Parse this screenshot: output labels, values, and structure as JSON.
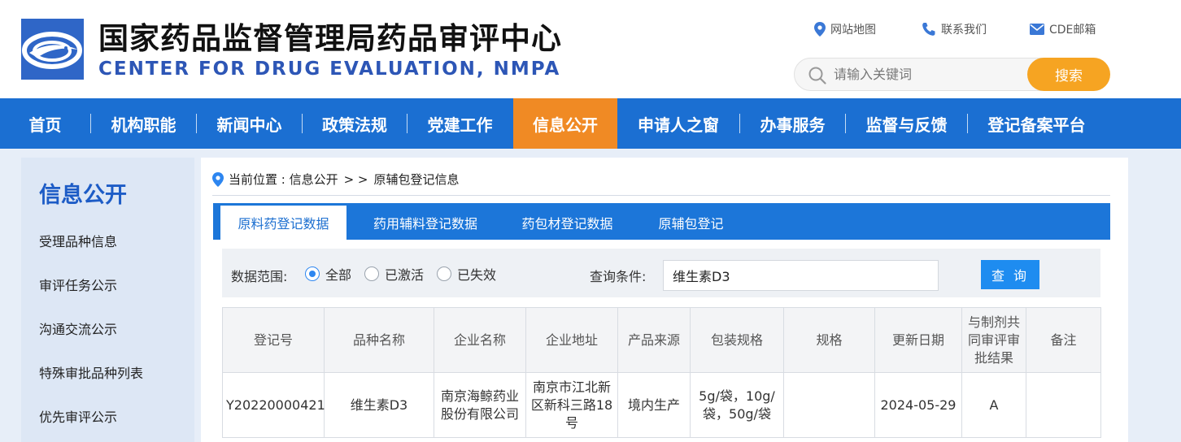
{
  "header": {
    "title": "国家药品监督管理局药品审评中心",
    "subtitle": "CENTER FOR DRUG EVALUATION, NMPA",
    "links": [
      {
        "label": "网站地图",
        "icon": "location-pin-icon"
      },
      {
        "label": "联系我们",
        "icon": "phone-icon"
      },
      {
        "label": "CDE邮箱",
        "icon": "mail-icon"
      }
    ],
    "search": {
      "placeholder": "请输入关键词",
      "button_label": "搜索"
    }
  },
  "nav": {
    "items": [
      {
        "label": "首页"
      },
      {
        "label": "机构职能"
      },
      {
        "label": "新闻中心"
      },
      {
        "label": "政策法规"
      },
      {
        "label": "党建工作"
      },
      {
        "label": "信息公开"
      },
      {
        "label": "申请人之窗"
      },
      {
        "label": "办事服务"
      },
      {
        "label": "监督与反馈"
      },
      {
        "label": "登记备案平台"
      }
    ],
    "active": "信息公开"
  },
  "sidebar": {
    "title": "信息公开",
    "items": [
      {
        "label": "受理品种信息"
      },
      {
        "label": "审评任务公示"
      },
      {
        "label": "沟通交流公示"
      },
      {
        "label": "特殊审批品种列表"
      },
      {
        "label": "优先审评公示"
      }
    ]
  },
  "breadcrumb": {
    "prefix": "当前位置 : 信息公开",
    "separator": "> >",
    "current": "原辅包登记信息"
  },
  "tabs": [
    {
      "label": "原料药登记数据",
      "active": true
    },
    {
      "label": "药用辅料登记数据",
      "active": false
    },
    {
      "label": "药包材登记数据",
      "active": false
    },
    {
      "label": "原辅包登记",
      "active": false
    }
  ],
  "filter": {
    "scope_label": "数据范围:",
    "options": [
      {
        "label": "全部",
        "checked": true
      },
      {
        "label": "已激活",
        "checked": false
      },
      {
        "label": "已失效",
        "checked": false
      }
    ],
    "query_label": "查询条件:",
    "query_value": "维生素D3",
    "query_button": "查 询"
  },
  "table": {
    "columns": [
      "登记号",
      "品种名称",
      "企业名称",
      "企业地址",
      "产品来源",
      "包装规格",
      "规格",
      "更新日期",
      "与制剂共同审评审批结果",
      "备注"
    ],
    "rows": [
      [
        "Y20220000421",
        "维生素D3",
        "南京海鲸药业股份有限公司",
        "南京市江北新区新科三路18号",
        "境内生产",
        "5g/袋，10g/袋，50g/袋",
        "",
        "2024-05-29",
        "A",
        ""
      ]
    ]
  },
  "colors": {
    "nav_bg": "#1b6fd2",
    "nav_active": "#f08a24",
    "search_button": "#f6a422",
    "tab_bar": "#1c76d9",
    "query_button": "#1e8cf0",
    "title_blue": "#1d5cc6"
  }
}
